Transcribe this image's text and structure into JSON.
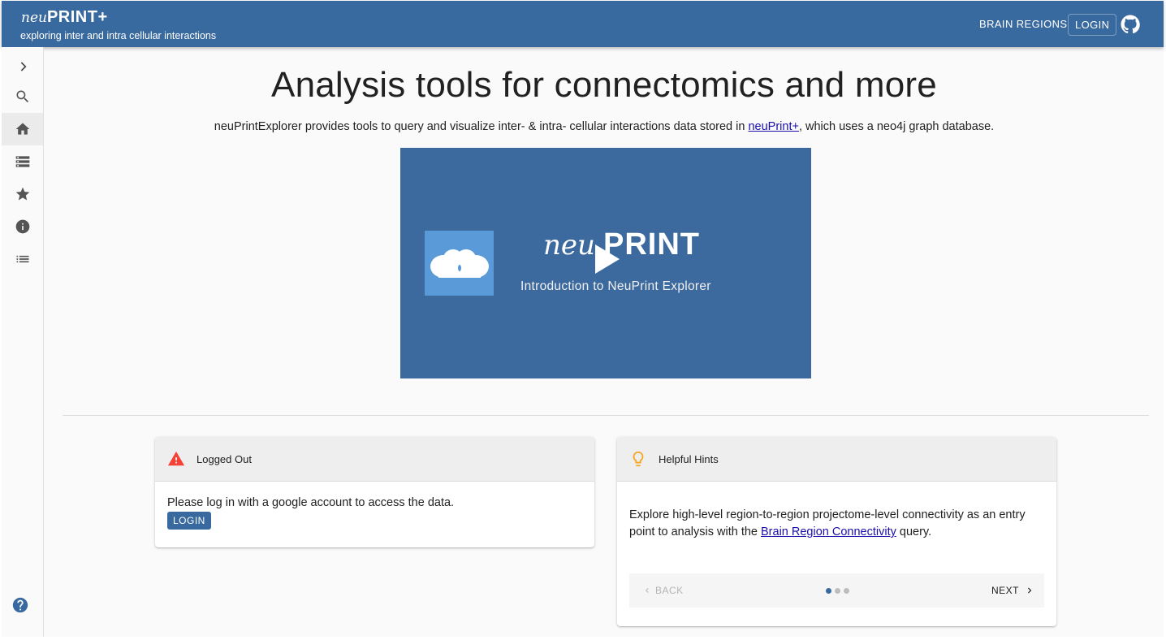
{
  "app": {
    "logo_neu": "neu",
    "logo_print": "PRINT+",
    "subtitle": "exploring inter and intra cellular interactions"
  },
  "header": {
    "brain_regions_label": "BRAIN REGIONS",
    "login_label": "LOGIN",
    "github_icon": "github-icon"
  },
  "sidebar": {
    "items": [
      {
        "icon": "chevron-right-icon"
      },
      {
        "icon": "search-icon"
      },
      {
        "icon": "home-icon",
        "active": true
      },
      {
        "icon": "storage-icon"
      },
      {
        "icon": "star-icon"
      },
      {
        "icon": "info-icon"
      },
      {
        "icon": "list-icon"
      }
    ],
    "help_icon": "help-icon"
  },
  "main": {
    "headline": "Analysis tools for connectomics and more",
    "intro_before": "neuPrintExplorer provides tools to query and visualize inter- & intra- cellular interactions data stored in ",
    "intro_link": "neuPrint+",
    "intro_after": ", which uses a neo4j graph database.",
    "video": {
      "brand_neu": "neu",
      "brand_print": "PRINT",
      "caption": "Introduction to NeuPrint Explorer"
    }
  },
  "cards": {
    "logged_out": {
      "title": "Logged Out",
      "message": "Please log in with a google account to access the data.",
      "login_label": "LOGIN",
      "accent": "#f44336"
    },
    "hints": {
      "title": "Helpful Hints",
      "text_before": "Explore high-level region-to-region projectome-level connectivity as an entry point to analysis with the ",
      "link": "Brain Region Connectivity",
      "text_after": " query.",
      "back_label": "BACK",
      "next_label": "NEXT",
      "step": 1,
      "steps": 3,
      "accent": "#f5a623"
    }
  },
  "colors": {
    "primary": "#396a9f",
    "link": "#1a0dab"
  }
}
